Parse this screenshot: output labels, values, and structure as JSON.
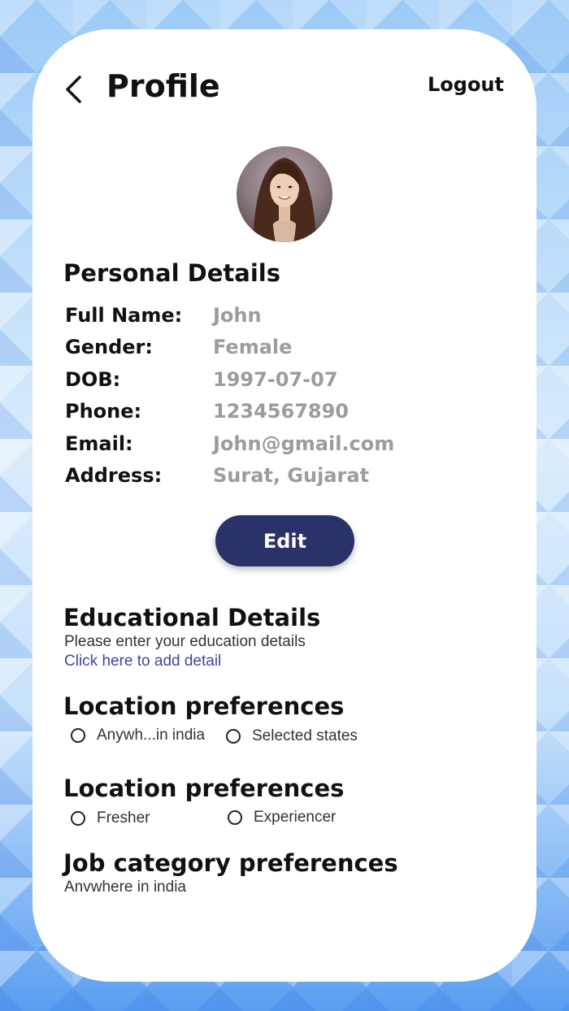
{
  "header": {
    "title": "Profile",
    "logout_label": "Logout",
    "back_icon": "chevron-left-icon"
  },
  "personal": {
    "title": "Personal Details",
    "rows": [
      {
        "label": "Full Name:",
        "value": "John"
      },
      {
        "label": "Gender:",
        "value": "Female"
      },
      {
        "label": "DOB:",
        "value": "1997-07-07"
      },
      {
        "label": "Phone:",
        "value": "1234567890"
      },
      {
        "label": "Email:",
        "value": "John@gmail.com"
      },
      {
        "label": "Address:",
        "value": "Surat, Gujarat"
      }
    ],
    "edit_label": "Edit"
  },
  "education": {
    "title": "Educational Details",
    "hint": "Please enter your education details",
    "link": "Click here to add detail"
  },
  "location1": {
    "title": "Location preferences",
    "options": [
      "Anywh...in india",
      "Selected states"
    ]
  },
  "location2": {
    "title": "Location preferences",
    "options": [
      "Fresher",
      "Experiencer"
    ]
  },
  "job": {
    "title": "Job category preferences",
    "value": "Anvwhere in india"
  },
  "colors": {
    "primary": "#2b3169",
    "link": "#3b46a8",
    "value_text": "#9c9c9c"
  }
}
